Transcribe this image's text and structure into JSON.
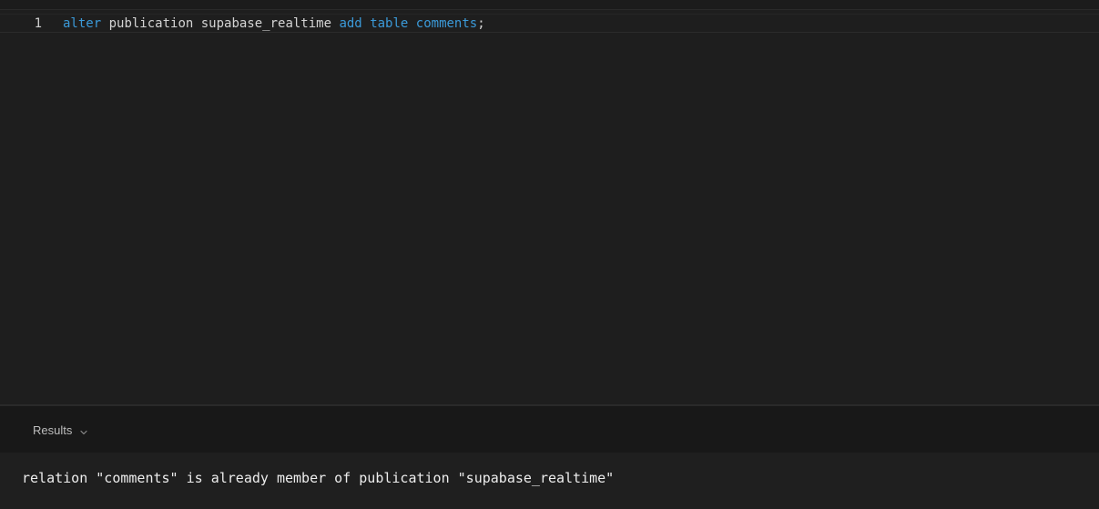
{
  "editor": {
    "line_number": "1",
    "tokens": {
      "alter": "alter",
      "publication": " publication supabase_realtime ",
      "add": "add",
      "sp1": " ",
      "table": "table",
      "sp2": " ",
      "comments": "comments",
      "semicolon": ";"
    }
  },
  "results": {
    "label": "Results",
    "chevron_icon": "chevron-down-icon",
    "message": "relation \"comments\" is already member of publication \"supabase_realtime\""
  },
  "colors": {
    "background": "#1e1e1e",
    "keyword": "#3b9ad9",
    "text": "#d4d4d4"
  }
}
